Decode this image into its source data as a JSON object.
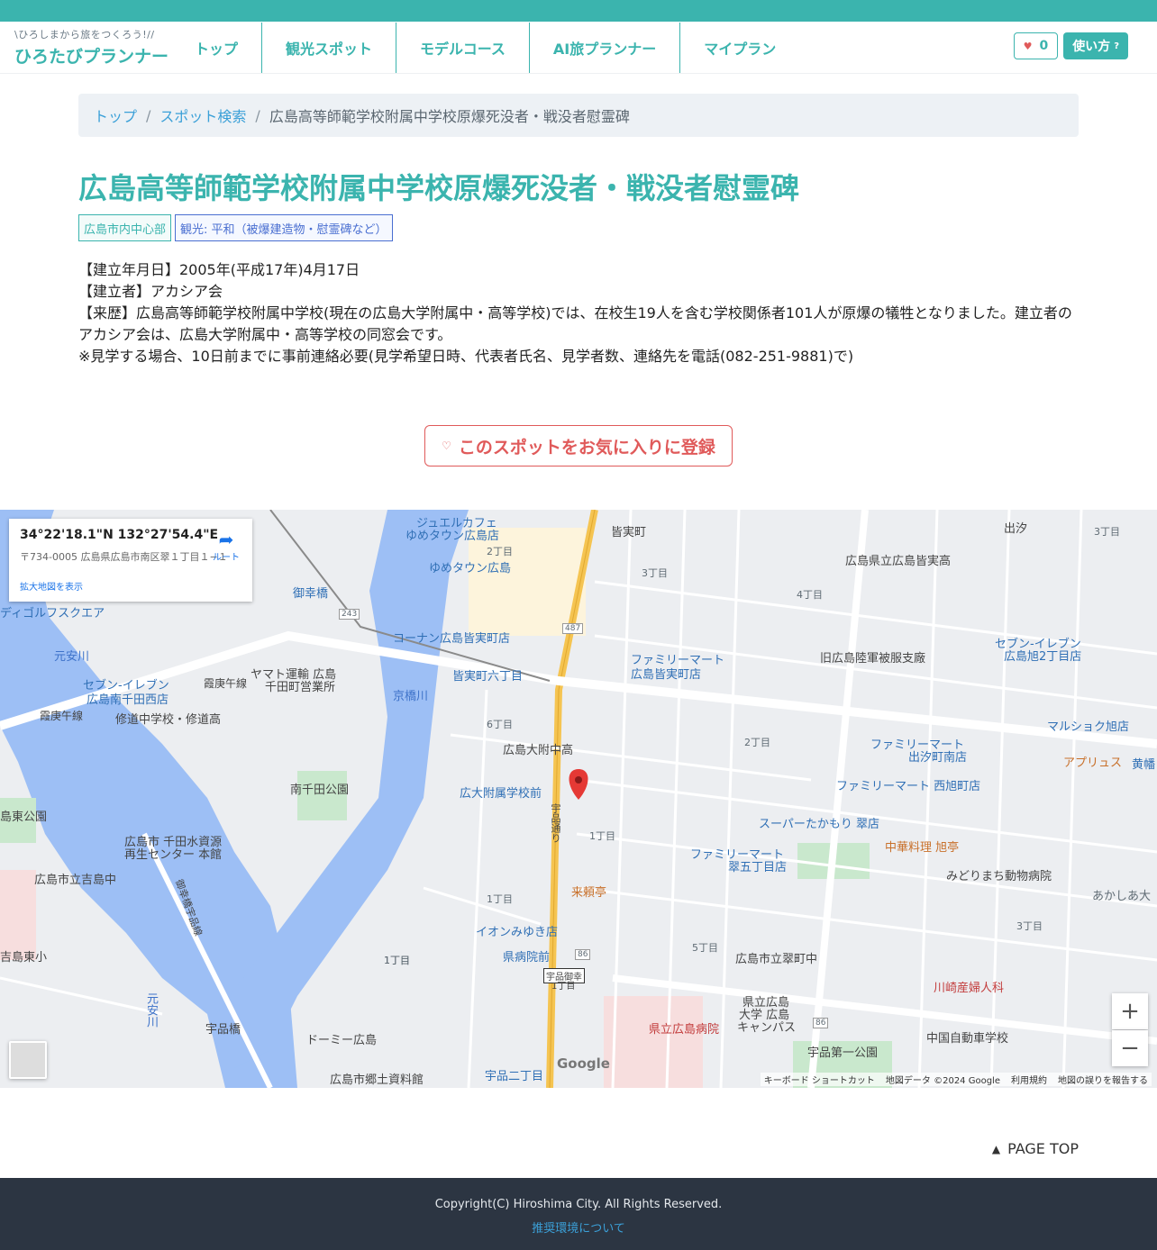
{
  "header": {
    "logo_tagline": "\\ひろしまから旅をつくろう!//",
    "logo_name": "ひろたびプランナー",
    "nav": [
      {
        "label": "トップ"
      },
      {
        "label": "観光スポット"
      },
      {
        "label": "モデルコース"
      },
      {
        "label": "AI旅プランナー"
      },
      {
        "label": "マイプラン"
      }
    ],
    "favorite_count": "0",
    "howto_label": "使い方"
  },
  "breadcrumb": {
    "items": [
      "トップ",
      "スポット検索"
    ],
    "current": "広島高等師範学校附属中学校原爆死没者・戦没者慰霊碑"
  },
  "spot": {
    "title": "広島高等師範学校附属中学校原爆死没者・戦没者慰霊碑",
    "tags": [
      "広島市内中心部",
      "観光: 平和（被爆建造物・慰霊碑など）"
    ],
    "description": [
      "【建立年月日】2005年(平成17年)4月17日",
      "【建立者】アカシア会",
      "【来歴】広島高等師範学校附属中学校(現在の広島大学附属中・高等学校)では、在校生19人を含む学校関係者101人が原爆の犠牲となりました。建立者のアカシア会は、広島大学附属中・高等学校の同窓会です。",
      "※見学する場合、10日前までに事前連絡必要(見学希望日時、代表者氏名、見学者数、連絡先を電話(082-251-9881)で)"
    ],
    "favorite_button": "このスポットをお気に入りに登録"
  },
  "map": {
    "coords": "34°22'18.1\"N 132°27'54.4\"E",
    "address": "〒734-0005 広島県広島市南区翠１丁目１−１",
    "larger_map": "拡大地図を表示",
    "route": "ルート",
    "zoom_in": "+",
    "zoom_out": "−",
    "attribution": [
      "キーボード ショートカット",
      "地図データ ©2024 Google",
      "利用規約",
      "地図の誤りを報告する"
    ],
    "google": "Google",
    "labels": [
      {
        "text": "ジュエルカフェ",
        "style": "blue"
      },
      {
        "text": "ゆめタウン広島店",
        "style": "blue"
      },
      {
        "text": "皆実町",
        "style": "dark"
      },
      {
        "text": "出汐",
        "style": "dark"
      },
      {
        "text": "3丁目",
        "style": ""
      },
      {
        "text": "2丁目",
        "style": ""
      },
      {
        "text": "ゆめタウン広島",
        "style": "blue"
      },
      {
        "text": "3丁目",
        "style": ""
      },
      {
        "text": "広島県立広島皆実高",
        "style": "dark"
      },
      {
        "text": "4丁目",
        "style": ""
      },
      {
        "text": "御幸橋",
        "style": "blue"
      },
      {
        "text": "ディゴルフスクエア",
        "style": "blue"
      },
      {
        "text": "コーナン広島皆実町店",
        "style": "blue"
      },
      {
        "text": "元安川",
        "style": "river"
      },
      {
        "text": "ファミリーマート",
        "style": "blue"
      },
      {
        "text": "広島皆実町店",
        "style": "blue"
      },
      {
        "text": "旧広島陸軍被服支廠",
        "style": "dark"
      },
      {
        "text": "セブン-イレブン",
        "style": "blue"
      },
      {
        "text": "広島旭2丁目店",
        "style": "blue"
      },
      {
        "text": "セブン-イレブン",
        "style": "blue"
      },
      {
        "text": "広島南千田西店",
        "style": "blue"
      },
      {
        "text": "霞庚午線",
        "style": "dark"
      },
      {
        "text": "ヤマト運輸 広島",
        "style": "dark"
      },
      {
        "text": "千田町営業所",
        "style": "dark"
      },
      {
        "text": "皆実町六丁目",
        "style": "blue"
      },
      {
        "text": "京橋川",
        "style": "river"
      },
      {
        "text": "霞庚午線",
        "style": "dark"
      },
      {
        "text": "修道中学校・修道高",
        "style": "dark"
      },
      {
        "text": "6丁目",
        "style": ""
      },
      {
        "text": "2丁目",
        "style": ""
      },
      {
        "text": "マルショク旭店",
        "style": "blue"
      },
      {
        "text": "広島大附中高",
        "style": "dark"
      },
      {
        "text": "ファミリーマート",
        "style": "blue"
      },
      {
        "text": "出汐町南店",
        "style": "blue"
      },
      {
        "text": "アプリュス",
        "style": "orange"
      },
      {
        "text": "黄幡",
        "style": "blue"
      },
      {
        "text": "南千田公園",
        "style": "dark"
      },
      {
        "text": "広大附属学校前",
        "style": "blue"
      },
      {
        "text": "ファミリーマート 西旭町店",
        "style": "blue"
      },
      {
        "text": "島東公園",
        "style": "dark"
      },
      {
        "text": "宇品通り",
        "style": "dark"
      },
      {
        "text": "1丁目",
        "style": ""
      },
      {
        "text": "スーパーたかもり 翠店",
        "style": "blue"
      },
      {
        "text": "広島市 千田水資源",
        "style": "dark"
      },
      {
        "text": "再生センター 本館",
        "style": "dark"
      },
      {
        "text": "中華料理 旭亭",
        "style": "orange"
      },
      {
        "text": "ファミリーマート",
        "style": "blue"
      },
      {
        "text": "翠五丁目店",
        "style": "blue"
      },
      {
        "text": "広島市立吉島中",
        "style": "dark"
      },
      {
        "text": "来頼亭",
        "style": "orange"
      },
      {
        "text": "みどりまち動物病院",
        "style": "dark"
      },
      {
        "text": "あかしあ大",
        "style": ""
      },
      {
        "text": "御幸橋宇品線",
        "style": "dark"
      },
      {
        "text": "1丁目",
        "style": ""
      },
      {
        "text": "1丁目",
        "style": ""
      },
      {
        "text": "イオンみゆき店",
        "style": "blue"
      },
      {
        "text": "3丁目",
        "style": ""
      },
      {
        "text": "県病院前",
        "style": "blue"
      },
      {
        "text": "5丁目",
        "style": ""
      },
      {
        "text": "広島市立翠町中",
        "style": "dark"
      },
      {
        "text": "吉島東小",
        "style": "dark"
      },
      {
        "text": "1丁目",
        "style": ""
      },
      {
        "text": "宇品御幸",
        "style": "dark"
      },
      {
        "text": "1丁目",
        "style": "dark"
      },
      {
        "text": "川崎産婦人科",
        "style": "red"
      },
      {
        "text": "元安川",
        "style": "river"
      },
      {
        "text": "県立広島",
        "style": "dark"
      },
      {
        "text": "大学 広島",
        "style": "dark"
      },
      {
        "text": "キャンパス",
        "style": "dark"
      },
      {
        "text": "中国自動車学校",
        "style": "dark"
      },
      {
        "text": "宇品橋",
        "style": "dark"
      },
      {
        "text": "県立広島病院",
        "style": "red"
      },
      {
        "text": "ドーミー広島",
        "style": "dark"
      },
      {
        "text": "宇品第一公園",
        "style": "dark"
      },
      {
        "text": "広島市郷土資料館",
        "style": "dark"
      },
      {
        "text": "宇品二丁目",
        "style": "blue"
      },
      {
        "text": "243",
        "style": ""
      },
      {
        "text": "487",
        "style": ""
      },
      {
        "text": "86",
        "style": ""
      },
      {
        "text": "86",
        "style": ""
      }
    ]
  },
  "page_top": "PAGE TOP",
  "footer": {
    "copyright": "Copyright(C) Hiroshima City. All Rights Reserved.",
    "env_link": "推奨環境について"
  }
}
